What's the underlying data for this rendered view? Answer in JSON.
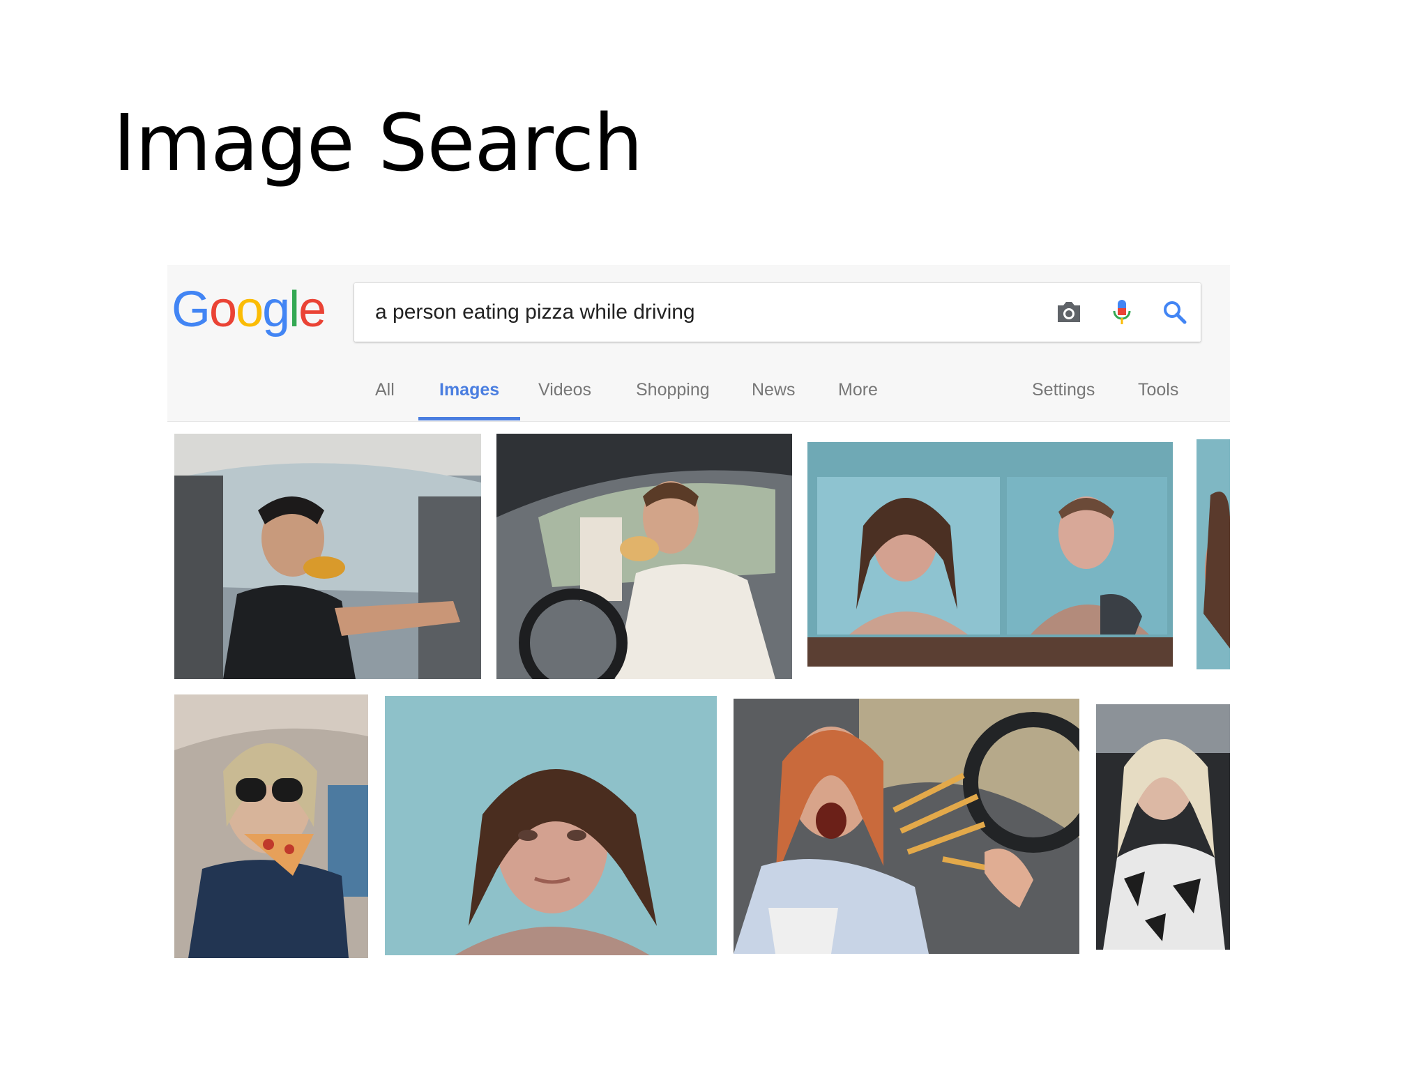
{
  "slide": {
    "title": "Image Search"
  },
  "google": {
    "logo_letters": [
      "G",
      "o",
      "o",
      "g",
      "l",
      "e"
    ],
    "logo_colors": [
      "#4285F4",
      "#EA4335",
      "#FBBC05",
      "#4285F4",
      "#34A853",
      "#EA4335"
    ],
    "search": {
      "query": "a person eating pizza while driving"
    },
    "icons": [
      "camera-icon",
      "microphone-icon",
      "search-icon"
    ],
    "tabs": [
      {
        "label": "All",
        "active": false
      },
      {
        "label": "Images",
        "active": true
      },
      {
        "label": "Videos",
        "active": false
      },
      {
        "label": "Shopping",
        "active": false
      },
      {
        "label": "News",
        "active": false
      },
      {
        "label": "More",
        "active": false
      }
    ],
    "right_tabs": [
      {
        "label": "Settings"
      },
      {
        "label": "Tools"
      }
    ],
    "accent_color": "#4a7ee0"
  },
  "results": {
    "thumbnails": [
      "young-man-eating-pizza-in-car",
      "man-eating-sandwich-while-driving",
      "two-mugshots-woman-and-tattooed-man",
      "partial-mugshot-cropped",
      "woman-in-sunglasses-eating-pizza-in-car",
      "woman-mugshot-teal-background",
      "woman-eating-fries-while-driving",
      "blonde-woman-in-car"
    ]
  }
}
